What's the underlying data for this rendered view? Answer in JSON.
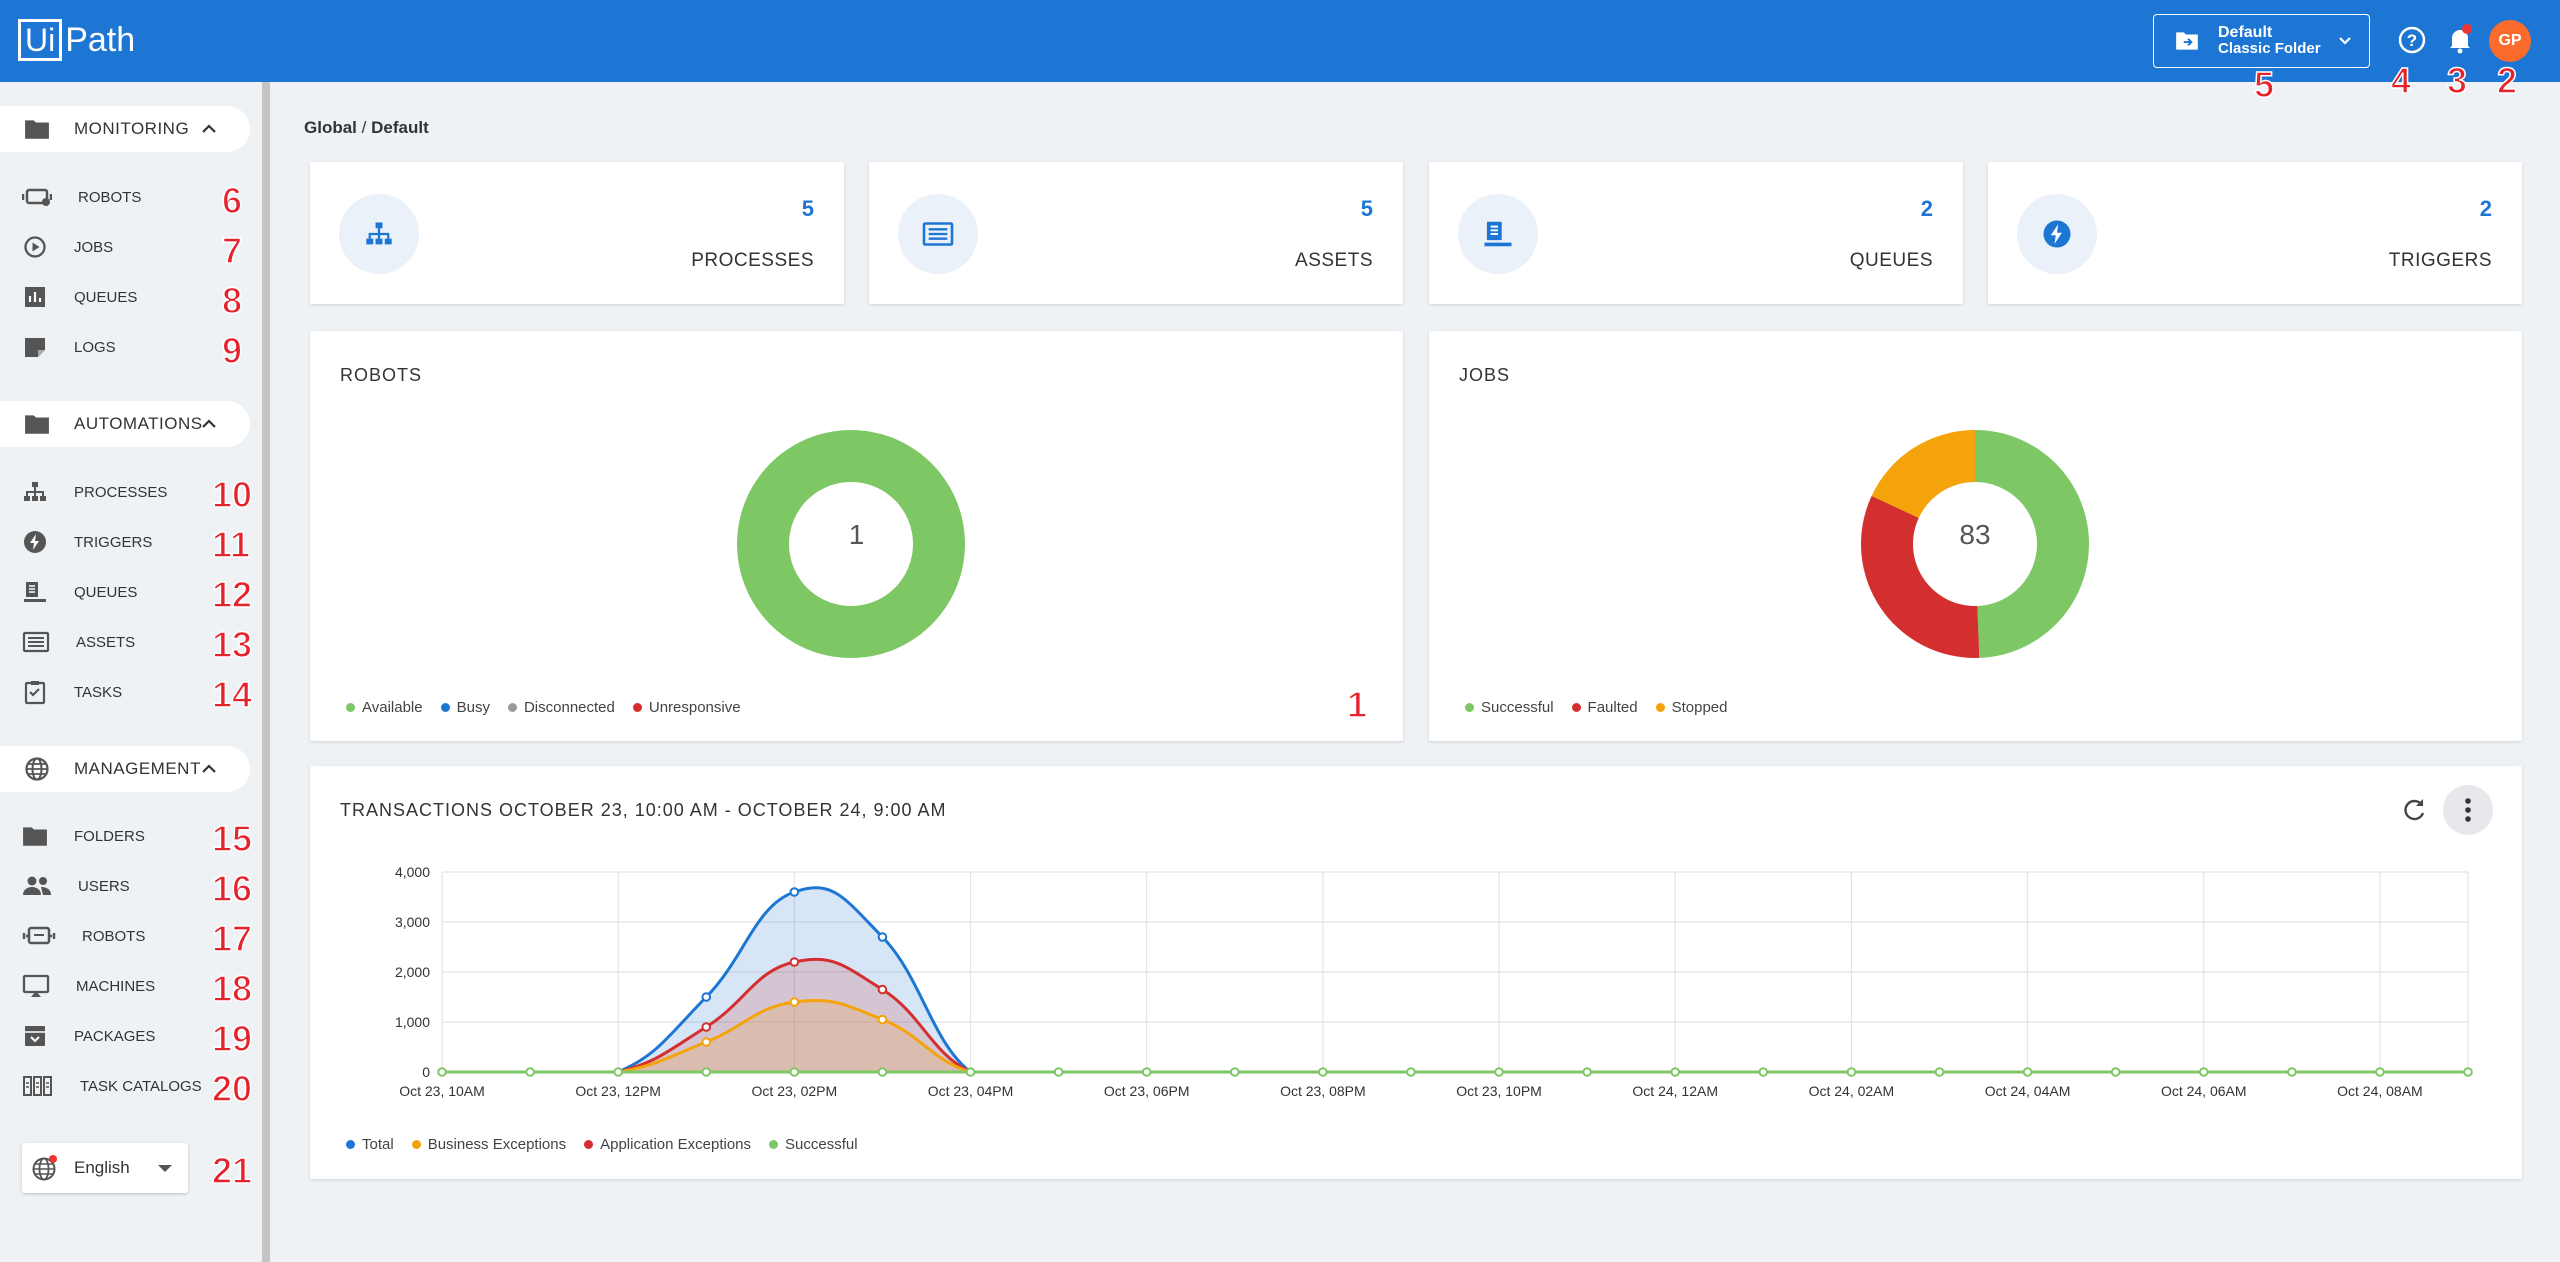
{
  "header": {
    "brand": "UiPath",
    "folder_name": "Default",
    "folder_type": "Classic Folder",
    "avatar_initials": "GP"
  },
  "annotations": [
    "1",
    "2",
    "3",
    "4",
    "5",
    "6",
    "7",
    "8",
    "9",
    "10",
    "11",
    "12",
    "13",
    "14",
    "15",
    "16",
    "17",
    "18",
    "19",
    "20",
    "21"
  ],
  "sidebar": {
    "sections": {
      "monitoring": "MONITORING",
      "automations": "AUTOMATIONS",
      "management": "MANAGEMENT"
    },
    "monitoring_items": [
      "ROBOTS",
      "JOBS",
      "QUEUES",
      "LOGS"
    ],
    "automation_items": [
      "PROCESSES",
      "TRIGGERS",
      "QUEUES",
      "ASSETS",
      "TASKS"
    ],
    "management_items": [
      "FOLDERS",
      "USERS",
      "ROBOTS",
      "MACHINES",
      "PACKAGES",
      "TASK CATALOGS"
    ],
    "language": "English"
  },
  "breadcrumb": {
    "root": "Global",
    "sep": "/",
    "current": "Default"
  },
  "stats": [
    {
      "value": "5",
      "label": "PROCESSES",
      "icon": "sitemap-icon"
    },
    {
      "value": "5",
      "label": "ASSETS",
      "icon": "asset-icon"
    },
    {
      "value": "2",
      "label": "QUEUES",
      "icon": "queue-icon"
    },
    {
      "value": "2",
      "label": "TRIGGERS",
      "icon": "bolt-icon"
    }
  ],
  "robots_card": {
    "title": "ROBOTS",
    "center": "1",
    "legend": [
      "Available",
      "Busy",
      "Disconnected",
      "Unresponsive"
    ],
    "legend_colors": [
      "#7dc765",
      "#1d76d3",
      "#9a9a9a",
      "#d32f2f"
    ],
    "chart_data": {
      "type": "pie",
      "categories": [
        "Available",
        "Busy",
        "Disconnected",
        "Unresponsive"
      ],
      "values": [
        1,
        0,
        0,
        0
      ],
      "colors": [
        "#7dc765",
        "#1d76d3",
        "#9a9a9a",
        "#d32f2f"
      ]
    }
  },
  "jobs_card": {
    "title": "JOBS",
    "center": "83",
    "legend": [
      "Successful",
      "Faulted",
      "Stopped"
    ],
    "legend_colors": [
      "#7dc765",
      "#d32f2f",
      "#f5a30a"
    ],
    "chart_data": {
      "type": "pie",
      "categories": [
        "Successful",
        "Faulted",
        "Stopped"
      ],
      "values": [
        41,
        27,
        15
      ],
      "colors": [
        "#7dc765",
        "#d32f2f",
        "#f5a30a"
      ]
    }
  },
  "transactions": {
    "title": "TRANSACTIONS OCTOBER 23, 10:00 AM - OCTOBER 24, 9:00 AM",
    "legend": [
      "Total",
      "Business Exceptions",
      "Application Exceptions",
      "Successful"
    ],
    "legend_colors": [
      "#1d76d3",
      "#f5a30a",
      "#d32f2f",
      "#7dc765"
    ],
    "chart_data": {
      "type": "area",
      "x_ticks": [
        "Oct 23, 10AM",
        "Oct 23, 12PM",
        "Oct 23, 02PM",
        "Oct 23, 04PM",
        "Oct 23, 06PM",
        "Oct 23, 08PM",
        "Oct 23, 10PM",
        "Oct 24, 12AM",
        "Oct 24, 02AM",
        "Oct 24, 04AM",
        "Oct 24, 06AM",
        "Oct 24, 08AM"
      ],
      "y_ticks": [
        "0",
        "1,000",
        "2,000",
        "3,000",
        "4,000"
      ],
      "ylim": [
        0,
        4000
      ],
      "x_hours": [
        0,
        1,
        2,
        3,
        4,
        5,
        6,
        7,
        8,
        9,
        10,
        11,
        12,
        13,
        14,
        15,
        16,
        17,
        18,
        19,
        20,
        21,
        22,
        23
      ],
      "series": [
        {
          "name": "Total",
          "color": "#1d76d3",
          "values": [
            0,
            0,
            0,
            1500,
            3600,
            2700,
            0,
            0,
            0,
            0,
            0,
            0,
            0,
            0,
            0,
            0,
            0,
            0,
            0,
            0,
            0,
            0,
            0,
            0
          ]
        },
        {
          "name": "Application Exceptions",
          "color": "#d32f2f",
          "values": [
            0,
            0,
            0,
            900,
            2200,
            1650,
            0,
            0,
            0,
            0,
            0,
            0,
            0,
            0,
            0,
            0,
            0,
            0,
            0,
            0,
            0,
            0,
            0,
            0
          ]
        },
        {
          "name": "Business Exceptions",
          "color": "#f5a30a",
          "values": [
            0,
            0,
            0,
            600,
            1400,
            1050,
            0,
            0,
            0,
            0,
            0,
            0,
            0,
            0,
            0,
            0,
            0,
            0,
            0,
            0,
            0,
            0,
            0,
            0
          ]
        },
        {
          "name": "Successful",
          "color": "#7dc765",
          "values": [
            0,
            0,
            0,
            0,
            0,
            0,
            0,
            0,
            0,
            0,
            0,
            0,
            0,
            0,
            0,
            0,
            0,
            0,
            0,
            0,
            0,
            0,
            0,
            0
          ]
        }
      ]
    }
  }
}
